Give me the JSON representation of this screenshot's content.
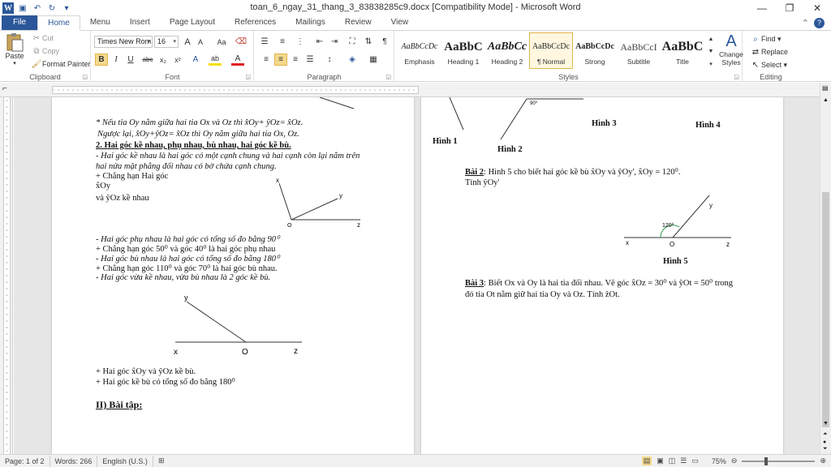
{
  "window": {
    "title": "toan_6_ngay_31_thang_3_83838285c9.docx [Compatibility Mode] - Microsoft Word",
    "minimize": "—",
    "restore": "❐",
    "close": "✕"
  },
  "tabs": [
    "File",
    "Home",
    "Menu",
    "Insert",
    "Page Layout",
    "References",
    "Mailings",
    "Review",
    "View"
  ],
  "clipboard": {
    "label": "Clipboard",
    "paste": "Paste",
    "cut": "Cut",
    "copy": "Copy",
    "format_painter": "Format Painter"
  },
  "font": {
    "label": "Font",
    "name": "Times New Rom",
    "size": "16",
    "bold": "B",
    "italic": "I",
    "underline": "U",
    "strike": "abc",
    "sub": "x₂",
    "sup": "x²",
    "grow": "A",
    "shrink": "A",
    "case": "Aa",
    "highlight": "ab",
    "color": "A"
  },
  "paragraph": {
    "label": "Paragraph",
    "pilcrow": "¶"
  },
  "styles": {
    "label": "Styles",
    "items": [
      {
        "preview": "AaBbCcDc",
        "name": "Emphasis",
        "size": "10px",
        "style": "italic",
        "weight": "normal"
      },
      {
        "preview": "AaBbC",
        "name": "Heading 1",
        "size": "15px",
        "style": "normal",
        "weight": "bold"
      },
      {
        "preview": "AaBbCc",
        "name": "Heading 2",
        "size": "14px",
        "style": "italic",
        "weight": "bold"
      },
      {
        "preview": "AaBbCcDc",
        "name": "¶ Normal",
        "size": "10px",
        "style": "normal",
        "weight": "normal"
      },
      {
        "preview": "AaBbCcDc",
        "name": "Strong",
        "size": "10px",
        "style": "normal",
        "weight": "bold"
      },
      {
        "preview": "AaBbCcI",
        "name": "Subtitle",
        "size": "12px",
        "style": "normal",
        "weight": "normal"
      },
      {
        "preview": "AaBbC",
        "name": "Title",
        "size": "16px",
        "style": "normal",
        "weight": "bold"
      }
    ],
    "change_styles": "Change Styles"
  },
  "editing": {
    "label": "Editing",
    "find": "Find",
    "replace": "Replace",
    "select": "Select"
  },
  "status": {
    "page": "Page: 1 of 2",
    "words": "Words: 266",
    "language": "English (U.S.)",
    "zoom": "75%"
  },
  "page1": {
    "line1": "* Nếu tia Oy nằm giữa hai tia Ox và Oz thì x̂Oy+ ŷOz= x̂Oz.",
    "line2": "Ngược lại, x̂Oy+ŷOz= x̂Oz thì Oy nằm giữa hai tia Ox, Oz.",
    "heading2": "2.  Hai góc kề nhau, phụ nhau, bù nhau, hai góc kề bù.",
    "line3": "-  Hai góc kề nhau là hai góc có một cạnh chung và hai cạnh còn lại nằm trên",
    "line4": "hai nửa mặt phẳng đối nhau có bờ chứa cạnh chung.",
    "line5": "+   Chẳng   hạn   Hai   góc",
    "line6": "x̂Oy",
    "line7": " và ŷOz  kề nhau",
    "line8": "-  Hai góc phụ nhau là hai góc có tổng số đo bằng 90⁰",
    "line9": "+ Chẳng hạn góc 50⁰  và góc 40⁰ là hai góc phụ nhau",
    "line10": "- Hai góc bù nhau là hai góc có tổng số đo bằng 180⁰",
    "line11": "+ Chẳng hạn góc 110⁰  và góc 70⁰ là hai góc bù nhau.",
    "line12": "- Hai góc vừa kề nhau, vừa bù nhau là 2 góc kề bù.",
    "line13": "+ Hai góc x̂Oy và ŷOz kề bù.",
    "line14": "+ Hai góc kề bù có tổng số đo bằng 180⁰",
    "section": "II) Bài tập:",
    "fig1": {
      "x": "x",
      "y": "y",
      "o": "O",
      "z": "z"
    },
    "fig2": {
      "x": "x",
      "y": "y",
      "o": "O",
      "z": "z"
    }
  },
  "page2": {
    "h1": "Hình 1",
    "h2": "Hình 2",
    "h3": "Hình 3",
    "h4": "Hình 4",
    "deg": "90⁰",
    "bai2_label": "Bài 2",
    "bai2_text": ":  Hình 5 cho biết hai góc kề bù x̂Oy và ŷOy', x̂Oy = 120⁰.",
    "bai2_text2": "Tính ŷOy'",
    "fig5": {
      "x": "x",
      "y": "y",
      "o": "O",
      "z": "z",
      "angle": "120⁰"
    },
    "h5": "Hình 5",
    "bai3_label": "Bài 3",
    "bai3_text": ": Biết Ox và Oy là hai tia đối nhau. Vẽ góc x̂Oz = 30⁰ và ŷOt  = 50⁰ trong",
    "bai3_text2": "đó tia Ot nằm giữ hai tia Oy và Oz. Tính ẑOt."
  }
}
